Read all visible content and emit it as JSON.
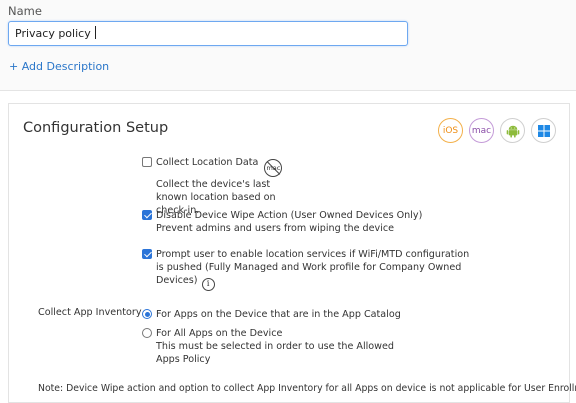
{
  "name": {
    "label": "Name",
    "value": "Privacy policy"
  },
  "add_description": "+ Add Description",
  "config": {
    "title": "Configuration Setup",
    "platforms": [
      {
        "label": "iOS",
        "icon": "ios-icon"
      },
      {
        "label": "mac",
        "icon": "mac-icon"
      },
      {
        "label": "",
        "icon": "android-icon"
      },
      {
        "label": "",
        "icon": "windows-icon"
      }
    ],
    "options": [
      {
        "checked": false,
        "title": "Collect Location Data",
        "desc": [
          "Collect the device's last known location based on",
          "check-in."
        ],
        "icon": "mac-not-supported-icon",
        "icon_text": "mac"
      },
      {
        "checked": true,
        "title": "Disable Device Wipe Action (User Owned Devices Only)",
        "desc": [
          "Prevent admins and users from wiping the device"
        ]
      },
      {
        "checked": true,
        "title": "Prompt user to enable location services if WiFi/MTD configuration",
        "desc": [
          "is pushed (Fully Managed and Work profile for Company Owned",
          "Devices)"
        ],
        "info_icon_text": "i"
      }
    ],
    "app_inventory": {
      "label": "Collect App Inventory",
      "choices": [
        {
          "selected": true,
          "title": "For Apps on the Device that are in the App Catalog"
        },
        {
          "selected": false,
          "title": "For All Apps on the Device",
          "desc": [
            "This must be selected in order to use the Allowed",
            "Apps Policy"
          ]
        }
      ]
    },
    "note": "Note: Device Wipe action and option to collect App Inventory for all Apps on device is not applicable for User Enrollment"
  }
}
